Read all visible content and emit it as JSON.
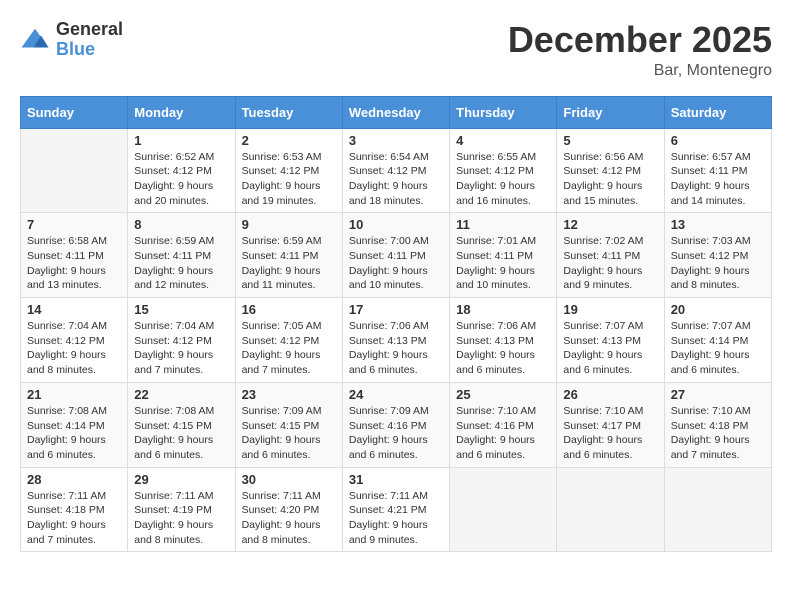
{
  "logo": {
    "general": "General",
    "blue": "Blue"
  },
  "header": {
    "month": "December 2025",
    "location": "Bar, Montenegro"
  },
  "weekdays": [
    "Sunday",
    "Monday",
    "Tuesday",
    "Wednesday",
    "Thursday",
    "Friday",
    "Saturday"
  ],
  "weeks": [
    [
      {
        "day": "",
        "info": ""
      },
      {
        "day": "1",
        "info": "Sunrise: 6:52 AM\nSunset: 4:12 PM\nDaylight: 9 hours\nand 20 minutes."
      },
      {
        "day": "2",
        "info": "Sunrise: 6:53 AM\nSunset: 4:12 PM\nDaylight: 9 hours\nand 19 minutes."
      },
      {
        "day": "3",
        "info": "Sunrise: 6:54 AM\nSunset: 4:12 PM\nDaylight: 9 hours\nand 18 minutes."
      },
      {
        "day": "4",
        "info": "Sunrise: 6:55 AM\nSunset: 4:12 PM\nDaylight: 9 hours\nand 16 minutes."
      },
      {
        "day": "5",
        "info": "Sunrise: 6:56 AM\nSunset: 4:12 PM\nDaylight: 9 hours\nand 15 minutes."
      },
      {
        "day": "6",
        "info": "Sunrise: 6:57 AM\nSunset: 4:11 PM\nDaylight: 9 hours\nand 14 minutes."
      }
    ],
    [
      {
        "day": "7",
        "info": "Sunrise: 6:58 AM\nSunset: 4:11 PM\nDaylight: 9 hours\nand 13 minutes."
      },
      {
        "day": "8",
        "info": "Sunrise: 6:59 AM\nSunset: 4:11 PM\nDaylight: 9 hours\nand 12 minutes."
      },
      {
        "day": "9",
        "info": "Sunrise: 6:59 AM\nSunset: 4:11 PM\nDaylight: 9 hours\nand 11 minutes."
      },
      {
        "day": "10",
        "info": "Sunrise: 7:00 AM\nSunset: 4:11 PM\nDaylight: 9 hours\nand 10 minutes."
      },
      {
        "day": "11",
        "info": "Sunrise: 7:01 AM\nSunset: 4:11 PM\nDaylight: 9 hours\nand 10 minutes."
      },
      {
        "day": "12",
        "info": "Sunrise: 7:02 AM\nSunset: 4:11 PM\nDaylight: 9 hours\nand 9 minutes."
      },
      {
        "day": "13",
        "info": "Sunrise: 7:03 AM\nSunset: 4:12 PM\nDaylight: 9 hours\nand 8 minutes."
      }
    ],
    [
      {
        "day": "14",
        "info": "Sunrise: 7:04 AM\nSunset: 4:12 PM\nDaylight: 9 hours\nand 8 minutes."
      },
      {
        "day": "15",
        "info": "Sunrise: 7:04 AM\nSunset: 4:12 PM\nDaylight: 9 hours\nand 7 minutes."
      },
      {
        "day": "16",
        "info": "Sunrise: 7:05 AM\nSunset: 4:12 PM\nDaylight: 9 hours\nand 7 minutes."
      },
      {
        "day": "17",
        "info": "Sunrise: 7:06 AM\nSunset: 4:13 PM\nDaylight: 9 hours\nand 6 minutes."
      },
      {
        "day": "18",
        "info": "Sunrise: 7:06 AM\nSunset: 4:13 PM\nDaylight: 9 hours\nand 6 minutes."
      },
      {
        "day": "19",
        "info": "Sunrise: 7:07 AM\nSunset: 4:13 PM\nDaylight: 9 hours\nand 6 minutes."
      },
      {
        "day": "20",
        "info": "Sunrise: 7:07 AM\nSunset: 4:14 PM\nDaylight: 9 hours\nand 6 minutes."
      }
    ],
    [
      {
        "day": "21",
        "info": "Sunrise: 7:08 AM\nSunset: 4:14 PM\nDaylight: 9 hours\nand 6 minutes."
      },
      {
        "day": "22",
        "info": "Sunrise: 7:08 AM\nSunset: 4:15 PM\nDaylight: 9 hours\nand 6 minutes."
      },
      {
        "day": "23",
        "info": "Sunrise: 7:09 AM\nSunset: 4:15 PM\nDaylight: 9 hours\nand 6 minutes."
      },
      {
        "day": "24",
        "info": "Sunrise: 7:09 AM\nSunset: 4:16 PM\nDaylight: 9 hours\nand 6 minutes."
      },
      {
        "day": "25",
        "info": "Sunrise: 7:10 AM\nSunset: 4:16 PM\nDaylight: 9 hours\nand 6 minutes."
      },
      {
        "day": "26",
        "info": "Sunrise: 7:10 AM\nSunset: 4:17 PM\nDaylight: 9 hours\nand 6 minutes."
      },
      {
        "day": "27",
        "info": "Sunrise: 7:10 AM\nSunset: 4:18 PM\nDaylight: 9 hours\nand 7 minutes."
      }
    ],
    [
      {
        "day": "28",
        "info": "Sunrise: 7:11 AM\nSunset: 4:18 PM\nDaylight: 9 hours\nand 7 minutes."
      },
      {
        "day": "29",
        "info": "Sunrise: 7:11 AM\nSunset: 4:19 PM\nDaylight: 9 hours\nand 8 minutes."
      },
      {
        "day": "30",
        "info": "Sunrise: 7:11 AM\nSunset: 4:20 PM\nDaylight: 9 hours\nand 8 minutes."
      },
      {
        "day": "31",
        "info": "Sunrise: 7:11 AM\nSunset: 4:21 PM\nDaylight: 9 hours\nand 9 minutes."
      },
      {
        "day": "",
        "info": ""
      },
      {
        "day": "",
        "info": ""
      },
      {
        "day": "",
        "info": ""
      }
    ]
  ]
}
